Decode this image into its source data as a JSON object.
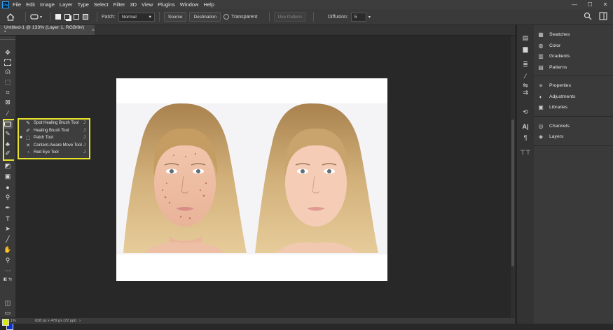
{
  "app": {
    "logo": "Ps"
  },
  "menu": [
    "File",
    "Edit",
    "Image",
    "Layer",
    "Type",
    "Select",
    "Filter",
    "3D",
    "View",
    "Plugins",
    "Window",
    "Help"
  ],
  "window_controls": {
    "minimize": "—",
    "maximize": "☐",
    "close": "✕"
  },
  "options": {
    "patch_label": "Patch:",
    "patch_value": "Normal",
    "source_label": "Source",
    "destination_label": "Destination",
    "transparent_label": "Transparent",
    "use_pattern_label": "Use Pattern",
    "diffusion_label": "Diffusion:",
    "diffusion_value": "5"
  },
  "document_tab": {
    "title": "Untitled-1 @ 133% (Layer 1, RGB/8#) *",
    "close": "×"
  },
  "flyout": {
    "items": [
      {
        "label": "Spot Healing Brush Tool",
        "shortcut": "J",
        "icon": "spot-healing-icon",
        "glyph": "✎",
        "selected": false
      },
      {
        "label": "Healing Brush Tool",
        "shortcut": "J",
        "icon": "healing-brush-icon",
        "glyph": "✐",
        "selected": false
      },
      {
        "label": "Patch Tool",
        "shortcut": "J",
        "icon": "patch-icon",
        "glyph": "⬚",
        "selected": true
      },
      {
        "label": "Content-Aware Move Tool",
        "shortcut": "J",
        "icon": "content-aware-move-icon",
        "glyph": "✕",
        "selected": false
      },
      {
        "label": "Red Eye Tool",
        "shortcut": "J",
        "icon": "red-eye-icon",
        "glyph": "◔",
        "selected": false
      }
    ]
  },
  "panels": {
    "group1": [
      {
        "label": "Swatches",
        "icon": "swatches-icon",
        "glyph": "▦"
      },
      {
        "label": "Color",
        "icon": "color-icon",
        "glyph": "◍"
      },
      {
        "label": "Gradients",
        "icon": "gradients-icon",
        "glyph": "▥"
      },
      {
        "label": "Patterns",
        "icon": "patterns-icon",
        "glyph": "▤"
      }
    ],
    "group2": [
      {
        "label": "Properties",
        "icon": "properties-icon",
        "glyph": "≡"
      },
      {
        "label": "Adjustments",
        "icon": "adjustments-icon",
        "glyph": "◐"
      },
      {
        "label": "Libraries",
        "icon": "libraries-icon",
        "glyph": "▣"
      }
    ],
    "group3": [
      {
        "label": "Channels",
        "icon": "channels-icon",
        "glyph": "◎"
      },
      {
        "label": "Layers",
        "icon": "layers-icon",
        "glyph": "◈"
      }
    ]
  },
  "status": {
    "zoom": "133.1%",
    "doc_size": "638 px x 479 px (72 ppi)"
  },
  "colors": {
    "foreground": "#d6ea10",
    "background": "#0b2fc9",
    "highlight": "#e8e22a"
  }
}
